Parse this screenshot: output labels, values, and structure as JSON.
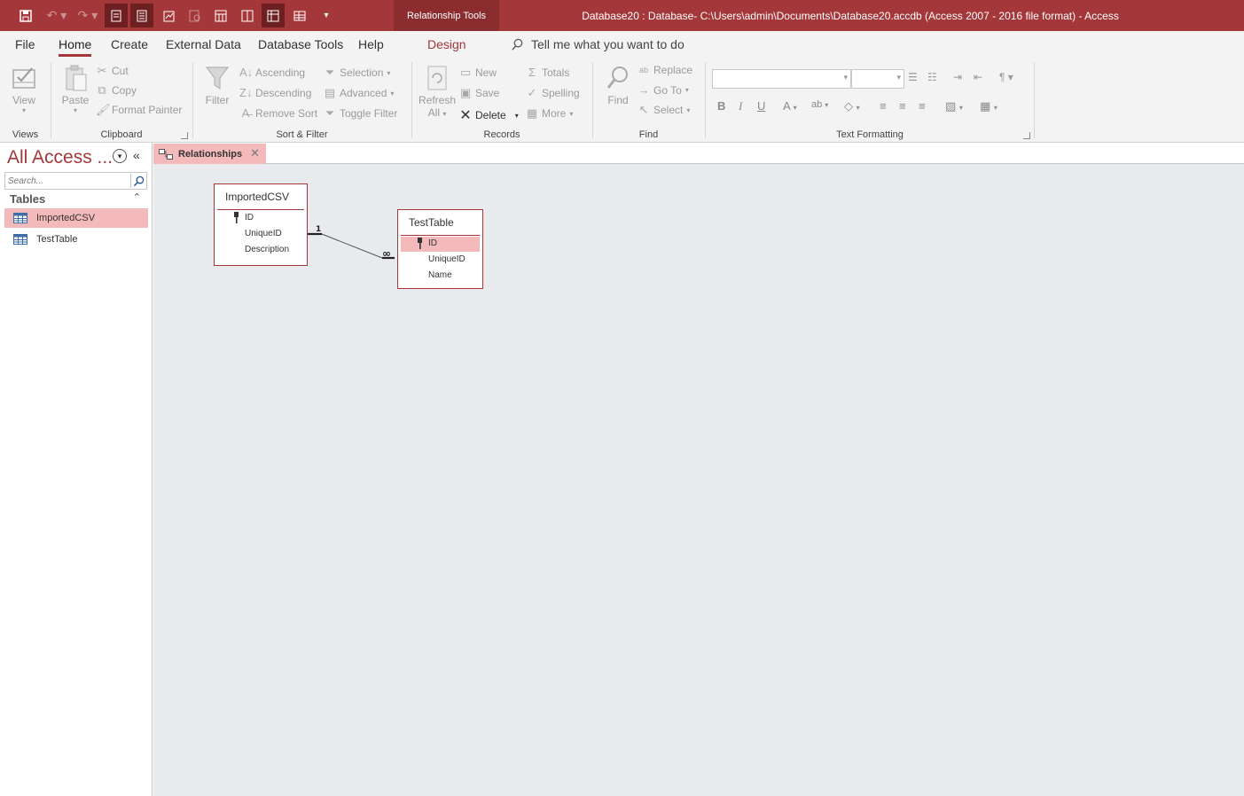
{
  "titlebar": {
    "contextual_tab": "Relationship Tools",
    "title": "Database20 : Database- C:\\Users\\admin\\Documents\\Database20.accdb (Access 2007 - 2016 file format)  -  Access"
  },
  "menu": {
    "file": "File",
    "home": "Home",
    "create": "Create",
    "external_data": "External Data",
    "database_tools": "Database Tools",
    "help": "Help",
    "design": "Design",
    "tell_me": "Tell me what you want to do"
  },
  "ribbon": {
    "views": {
      "label": "Views",
      "view": "View"
    },
    "clipboard": {
      "label": "Clipboard",
      "paste": "Paste",
      "cut": "Cut",
      "copy": "Copy",
      "format_painter": "Format Painter"
    },
    "sort_filter": {
      "label": "Sort & Filter",
      "filter": "Filter",
      "ascending": "Ascending",
      "descending": "Descending",
      "remove_sort": "Remove Sort",
      "selection": "Selection",
      "advanced": "Advanced",
      "toggle_filter": "Toggle Filter"
    },
    "records": {
      "label": "Records",
      "refresh": "Refresh",
      "refresh2": "All",
      "new": "New",
      "save": "Save",
      "delete": "Delete",
      "totals": "Totals",
      "spelling": "Spelling",
      "more": "More"
    },
    "find": {
      "label": "Find",
      "find": "Find",
      "replace": "Replace",
      "goto": "Go To",
      "select": "Select"
    },
    "text_formatting": {
      "label": "Text Formatting"
    }
  },
  "nav": {
    "title": "All Access ...",
    "search_placeholder": "Search...",
    "group_label": "Tables",
    "items": [
      {
        "label": "ImportedCSV",
        "selected": true
      },
      {
        "label": "TestTable",
        "selected": false
      }
    ]
  },
  "document": {
    "tab_label": "Relationships",
    "tables": [
      {
        "name": "ImportedCSV",
        "fields": [
          "ID",
          "UniqueID",
          "Description"
        ]
      },
      {
        "name": "TestTable",
        "fields": [
          "ID",
          "UniqueID",
          "Name"
        ]
      }
    ],
    "relationship": {
      "one_label": "1",
      "many_label": "∞"
    }
  },
  "colors": {
    "accent": "#a4373a",
    "selection": "#f4b9bb",
    "canvas": "#e8eaed"
  }
}
